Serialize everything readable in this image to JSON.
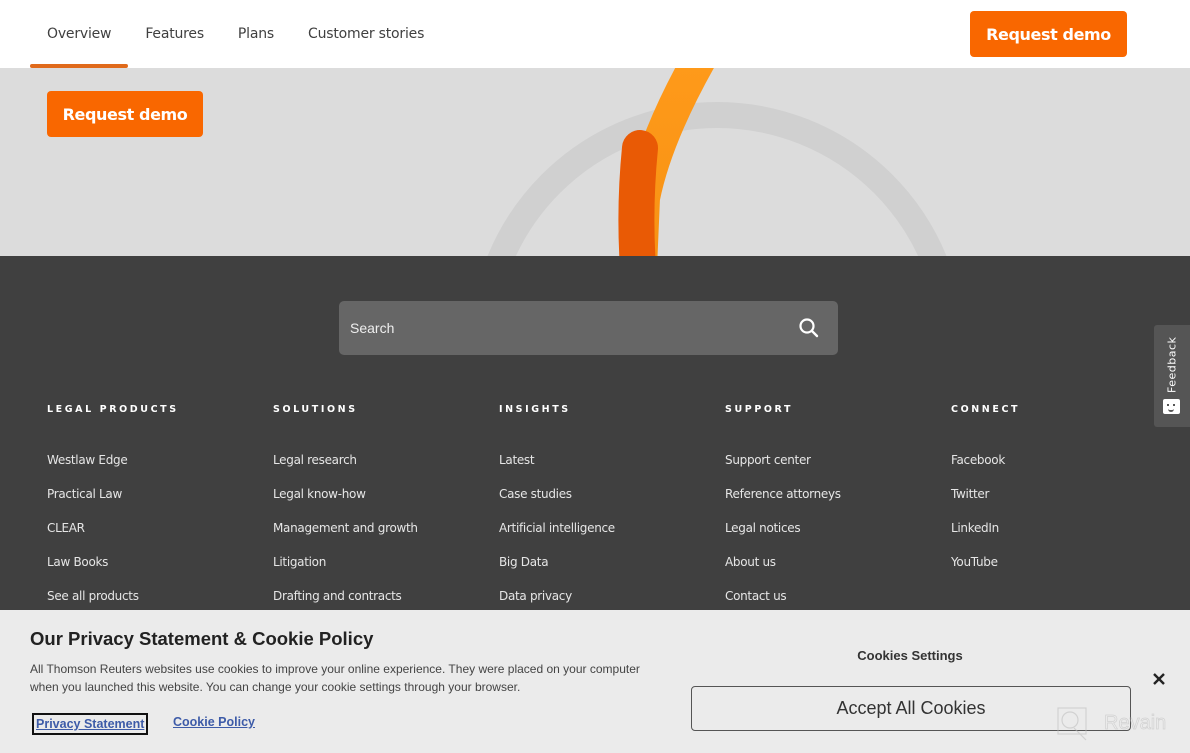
{
  "nav": {
    "tabs": [
      {
        "label": "Overview",
        "active": true
      },
      {
        "label": "Features",
        "active": false
      },
      {
        "label": "Plans",
        "active": false
      },
      {
        "label": "Customer stories",
        "active": false
      }
    ],
    "cta_label": "Request demo"
  },
  "hero": {
    "cta_label": "Request demo"
  },
  "footer": {
    "search": {
      "placeholder": "Search",
      "value": ""
    },
    "columns": [
      {
        "heading": "LEGAL PRODUCTS",
        "links": [
          "Westlaw Edge",
          "Practical Law",
          "CLEAR",
          "Law Books",
          "See all products"
        ]
      },
      {
        "heading": "SOLUTIONS",
        "links": [
          "Legal research",
          "Legal know-how",
          "Management and growth",
          "Litigation",
          "Drafting and contracts"
        ]
      },
      {
        "heading": "INSIGHTS",
        "links": [
          "Latest",
          "Case studies",
          "Artificial intelligence",
          "Big Data",
          "Data privacy"
        ]
      },
      {
        "heading": "SUPPORT",
        "links": [
          "Support center",
          "Reference attorneys",
          "Legal notices",
          "About us",
          "Contact us"
        ]
      },
      {
        "heading": "CONNECT",
        "links": [
          "Facebook",
          "Twitter",
          "LinkedIn",
          "YouTube"
        ]
      }
    ]
  },
  "feedback": {
    "label": "Feedback"
  },
  "cookie_banner": {
    "title": "Our Privacy Statement & Cookie Policy",
    "text": "All Thomson Reuters websites use cookies to improve your online experience. They were placed on your computer when you launched this website. You can change your cookie settings through your browser.",
    "privacy_link": "Privacy Statement",
    "cookie_link": "Cookie Policy",
    "settings_label": "Cookies Settings",
    "accept_label": "Accept All Cookies"
  },
  "watermark": {
    "text": "Revain"
  },
  "colors": {
    "accent_orange": "#f96700",
    "footer_bg": "#404040",
    "hero_bg": "#dcdcdc",
    "link_blue": "#3d5ba8"
  }
}
